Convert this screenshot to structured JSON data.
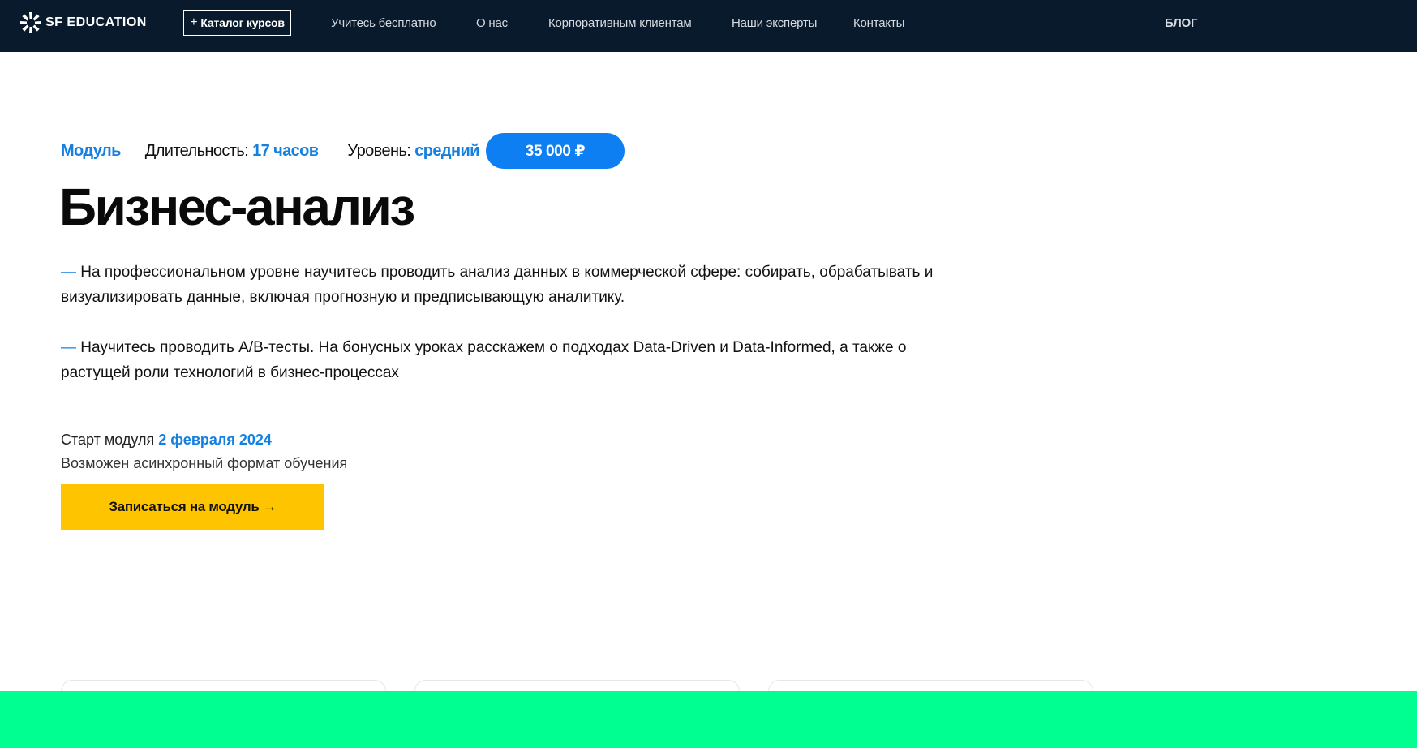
{
  "header": {
    "logo_text": "SF EDUCATION",
    "catalog_label": "Каталог курсов",
    "nav": [
      "Учитесь бесплатно",
      "О нас",
      "Корпоративным клиентам",
      "Наши эксперты",
      "Контакты"
    ],
    "blog_label": "БЛОГ"
  },
  "hero": {
    "type_label": "Модуль",
    "duration_label": "Длительность:",
    "duration_value": "17 часов",
    "level_label": "Уровень:",
    "level_value": "средний",
    "price": "35 000 ₽",
    "title": "Бизнес-анализ",
    "dash": "—",
    "paragraph1": "На профессиональном уровне научитесь проводить анализ данных в коммерческой сфере: собирать, обрабатывать и визуализировать данные, включая прогнозную и предписывающую аналитику.",
    "paragraph2": "Научитесь проводить A/B-тесты. На бонусных уроках расскажем о подходах Data-Driven и Data-Informed, а также о растущей роли технологий в бизнес-процессах",
    "start_label": "Старт модуля",
    "start_date": "2 февраля 2024",
    "async_note": "Возможен асинхронный формат обучения",
    "cta_label": "Записаться на модуль →"
  },
  "colors": {
    "header_bg": "#081a2b",
    "accent_blue": "#1580e0",
    "price_bg": "#0d7ff2",
    "cta_bg": "#ffc400",
    "band_green": "#00ff91"
  }
}
